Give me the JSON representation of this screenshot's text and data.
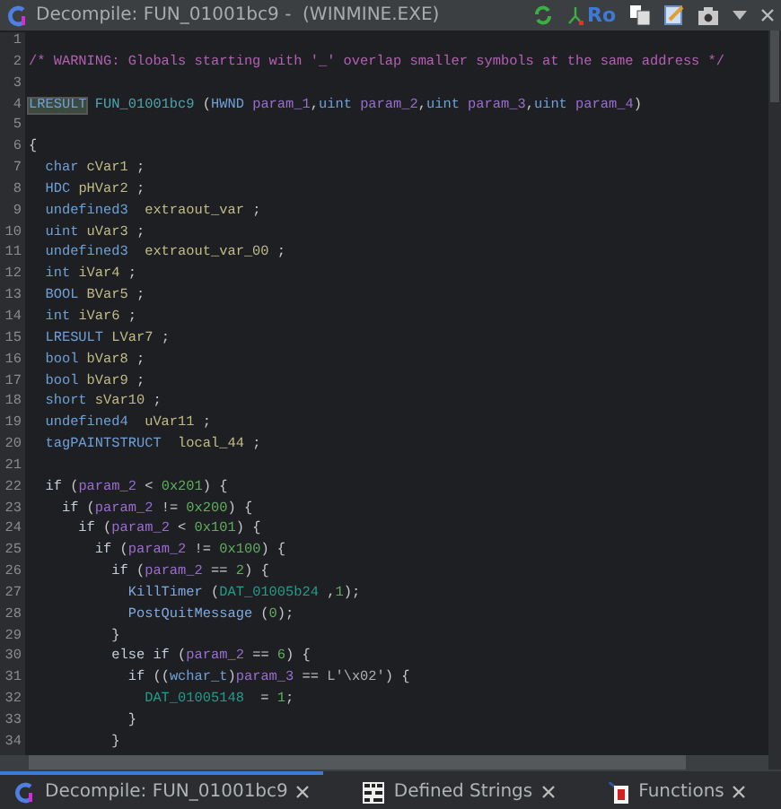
{
  "window": {
    "title": "Decompile: FUN_01001bc9 -  (WINMINE.EXE)",
    "toolbar_text": "Ro"
  },
  "lines": [
    {
      "number": "1"
    },
    {
      "number": "2",
      "tokens": [
        {
          "text": "/* WARNING: Globals starting with '_' overlap smaller symbols at the same address */",
          "kind": "comment"
        }
      ]
    },
    {
      "number": "3"
    },
    {
      "number": "4",
      "tokens": [
        {
          "text": "LRESULT",
          "kind": "type",
          "highlighted": true
        },
        {
          "text": " FUN_01001bc9 ",
          "kind": "funcname"
        },
        {
          "text": "(",
          "kind": "punct"
        },
        {
          "text": "HWND",
          "kind": "type"
        },
        {
          "text": " param_1",
          "kind": "param"
        },
        {
          "text": ",",
          "kind": "punct"
        },
        {
          "text": "uint",
          "kind": "type"
        },
        {
          "text": " param_2",
          "kind": "param"
        },
        {
          "text": ",",
          "kind": "punct"
        },
        {
          "text": "uint",
          "kind": "type"
        },
        {
          "text": " param_3",
          "kind": "param"
        },
        {
          "text": ",",
          "kind": "punct"
        },
        {
          "text": "uint",
          "kind": "type"
        },
        {
          "text": " param_4",
          "kind": "param"
        },
        {
          "text": ")",
          "kind": "punct"
        }
      ]
    },
    {
      "number": "5"
    },
    {
      "number": "6",
      "tokens": [
        {
          "text": "{",
          "kind": "punct"
        }
      ]
    },
    {
      "number": "7",
      "tokens": [
        {
          "text": "  char",
          "kind": "type"
        },
        {
          "text": " cVar1",
          "kind": "var"
        },
        {
          "text": " ;",
          "kind": "punct"
        }
      ]
    },
    {
      "number": "8",
      "tokens": [
        {
          "text": "  HDC",
          "kind": "type"
        },
        {
          "text": " pHVar2",
          "kind": "var"
        },
        {
          "text": " ;",
          "kind": "punct"
        }
      ]
    },
    {
      "number": "9",
      "tokens": [
        {
          "text": "  undefined3",
          "kind": "type"
        },
        {
          "text": "  extraout_var",
          "kind": "var"
        },
        {
          "text": " ;",
          "kind": "punct"
        }
      ]
    },
    {
      "number": "10",
      "tokens": [
        {
          "text": "  uint",
          "kind": "type"
        },
        {
          "text": " uVar3",
          "kind": "var"
        },
        {
          "text": " ;",
          "kind": "punct"
        }
      ]
    },
    {
      "number": "11",
      "tokens": [
        {
          "text": "  undefined3",
          "kind": "type"
        },
        {
          "text": "  extraout_var_00",
          "kind": "var"
        },
        {
          "text": " ;",
          "kind": "punct"
        }
      ]
    },
    {
      "number": "12",
      "tokens": [
        {
          "text": "  int",
          "kind": "type"
        },
        {
          "text": " iVar4",
          "kind": "var"
        },
        {
          "text": " ;",
          "kind": "punct"
        }
      ]
    },
    {
      "number": "13",
      "tokens": [
        {
          "text": "  BOOL",
          "kind": "type"
        },
        {
          "text": " BVar5",
          "kind": "var"
        },
        {
          "text": " ;",
          "kind": "punct"
        }
      ]
    },
    {
      "number": "14",
      "tokens": [
        {
          "text": "  int",
          "kind": "type"
        },
        {
          "text": " iVar6",
          "kind": "var"
        },
        {
          "text": " ;",
          "kind": "punct"
        }
      ]
    },
    {
      "number": "15",
      "tokens": [
        {
          "text": "  LRESULT",
          "kind": "type"
        },
        {
          "text": " LVar7",
          "kind": "var"
        },
        {
          "text": " ;",
          "kind": "punct"
        }
      ]
    },
    {
      "number": "16",
      "tokens": [
        {
          "text": "  bool",
          "kind": "type"
        },
        {
          "text": " bVar8",
          "kind": "var"
        },
        {
          "text": " ;",
          "kind": "punct"
        }
      ]
    },
    {
      "number": "17",
      "tokens": [
        {
          "text": "  bool",
          "kind": "type"
        },
        {
          "text": " bVar9",
          "kind": "var"
        },
        {
          "text": " ;",
          "kind": "punct"
        }
      ]
    },
    {
      "number": "18",
      "tokens": [
        {
          "text": "  short",
          "kind": "type"
        },
        {
          "text": " sVar10",
          "kind": "var"
        },
        {
          "text": " ;",
          "kind": "punct"
        }
      ]
    },
    {
      "number": "19",
      "tokens": [
        {
          "text": "  undefined4",
          "kind": "type"
        },
        {
          "text": "  uVar11",
          "kind": "var"
        },
        {
          "text": " ;",
          "kind": "punct"
        }
      ]
    },
    {
      "number": "20",
      "tokens": [
        {
          "text": "  tagPAINTSTRUCT",
          "kind": "type"
        },
        {
          "text": "  local_44",
          "kind": "var"
        },
        {
          "text": " ;",
          "kind": "punct"
        }
      ]
    },
    {
      "number": "21"
    },
    {
      "number": "22",
      "tokens": [
        {
          "text": "  if",
          "kind": "keyword"
        },
        {
          "text": " (",
          "kind": "punct"
        },
        {
          "text": "param_2",
          "kind": "param"
        },
        {
          "text": " < ",
          "kind": "punct"
        },
        {
          "text": "0x201",
          "kind": "number"
        },
        {
          "text": ") {",
          "kind": "punct"
        }
      ]
    },
    {
      "number": "23",
      "tokens": [
        {
          "text": "    if",
          "kind": "keyword"
        },
        {
          "text": " (",
          "kind": "punct"
        },
        {
          "text": "param_2",
          "kind": "param"
        },
        {
          "text": " != ",
          "kind": "punct"
        },
        {
          "text": "0x200",
          "kind": "number"
        },
        {
          "text": ") {",
          "kind": "punct"
        }
      ]
    },
    {
      "number": "24",
      "tokens": [
        {
          "text": "      if",
          "kind": "keyword"
        },
        {
          "text": " (",
          "kind": "punct"
        },
        {
          "text": "param_2",
          "kind": "param"
        },
        {
          "text": " < ",
          "kind": "punct"
        },
        {
          "text": "0x101",
          "kind": "number"
        },
        {
          "text": ") {",
          "kind": "punct"
        }
      ]
    },
    {
      "number": "25",
      "tokens": [
        {
          "text": "        if",
          "kind": "keyword"
        },
        {
          "text": " (",
          "kind": "punct"
        },
        {
          "text": "param_2",
          "kind": "param"
        },
        {
          "text": " != ",
          "kind": "punct"
        },
        {
          "text": "0x100",
          "kind": "number"
        },
        {
          "text": ") {",
          "kind": "punct"
        }
      ]
    },
    {
      "number": "26",
      "tokens": [
        {
          "text": "          if",
          "kind": "keyword"
        },
        {
          "text": " (",
          "kind": "punct"
        },
        {
          "text": "param_2",
          "kind": "param"
        },
        {
          "text": " == ",
          "kind": "punct"
        },
        {
          "text": "2",
          "kind": "number"
        },
        {
          "text": ") {",
          "kind": "punct"
        }
      ]
    },
    {
      "number": "27",
      "tokens": [
        {
          "text": "            KillTimer",
          "kind": "func"
        },
        {
          "text": " (",
          "kind": "punct"
        },
        {
          "text": "DAT_01005b24",
          "kind": "global"
        },
        {
          "text": " ,",
          "kind": "punct"
        },
        {
          "text": "1",
          "kind": "number"
        },
        {
          "text": ");",
          "kind": "punct"
        }
      ]
    },
    {
      "number": "28",
      "tokens": [
        {
          "text": "            PostQuitMessage",
          "kind": "func"
        },
        {
          "text": " (",
          "kind": "punct"
        },
        {
          "text": "0",
          "kind": "number"
        },
        {
          "text": ");",
          "kind": "punct"
        }
      ]
    },
    {
      "number": "29",
      "tokens": [
        {
          "text": "          }",
          "kind": "punct"
        }
      ]
    },
    {
      "number": "30",
      "tokens": [
        {
          "text": "          else if",
          "kind": "keyword"
        },
        {
          "text": " (",
          "kind": "punct"
        },
        {
          "text": "param_2",
          "kind": "param"
        },
        {
          "text": " == ",
          "kind": "punct"
        },
        {
          "text": "6",
          "kind": "number"
        },
        {
          "text": ") {",
          "kind": "punct"
        }
      ]
    },
    {
      "number": "31",
      "tokens": [
        {
          "text": "            if",
          "kind": "keyword"
        },
        {
          "text": " ((",
          "kind": "punct"
        },
        {
          "text": "wchar_t",
          "kind": "type"
        },
        {
          "text": ")",
          "kind": "punct"
        },
        {
          "text": "param_3",
          "kind": "param"
        },
        {
          "text": " == ",
          "kind": "punct"
        },
        {
          "text": "L'\\x02'",
          "kind": "string"
        },
        {
          "text": ") {",
          "kind": "punct"
        }
      ]
    },
    {
      "number": "32",
      "tokens": [
        {
          "text": "              DAT_01005148",
          "kind": "global"
        },
        {
          "text": "  = ",
          "kind": "punct"
        },
        {
          "text": "1",
          "kind": "number"
        },
        {
          "text": ";",
          "kind": "punct"
        }
      ]
    },
    {
      "number": "33",
      "tokens": [
        {
          "text": "            }",
          "kind": "punct"
        }
      ]
    },
    {
      "number": "34",
      "tokens": [
        {
          "text": "          }",
          "kind": "punct"
        }
      ]
    }
  ],
  "tabs": [
    {
      "label": "Decompile: FUN_01001bc9",
      "kind": "decompile",
      "selected": true
    },
    {
      "label": "Defined Strings",
      "kind": "strings",
      "selected": false
    },
    {
      "label": "Functions",
      "kind": "functions",
      "selected": false
    }
  ]
}
